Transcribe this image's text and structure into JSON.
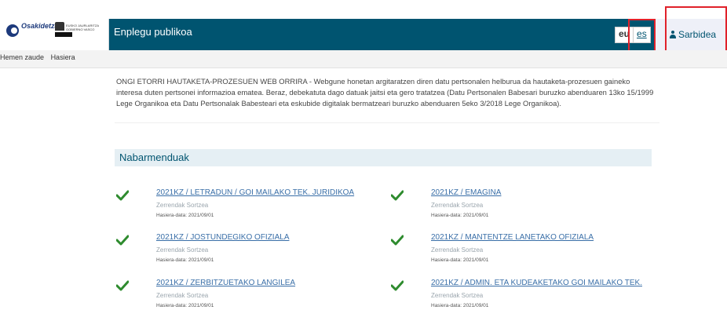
{
  "header": {
    "logo_text": "Osakidetza",
    "gov_text": "EUSKO JAURLARITZA GOBIERNO VASCO",
    "app_title": "Enplegu publikoa",
    "languages": [
      {
        "code": "eu",
        "active": true
      },
      {
        "code": "es",
        "active": false
      }
    ],
    "login_label": "Sarbidea",
    "colors": {
      "header_bg": "#005470",
      "highlight": "#e0212a"
    }
  },
  "breadcrumb": {
    "prefix": "Hemen zaude",
    "current": "Hasiera"
  },
  "intro": {
    "text": "ONGI ETORRI HAUTAKETA-PROZESUEN WEB ORRIRA - Webgune honetan argitaratzen diren datu pertsonalen helburua da hautaketa-prozesuen gaineko interesa duten pertsonei informazioa ematea. Beraz, debekatuta dago datuak jaitsi eta gero tratatzea (Datu Pertsonalen Babesari buruzko abenduaren 13ko 15/1999 Lege Organikoa eta Datu Pertsonalak Babesteari eta eskubide digitalak bermatzeari buruzko abenduaren 5eko 3/2018 Lege Organikoa)."
  },
  "featured": {
    "title": "Nabarmenduak",
    "items": [
      {
        "link": "2021KZ / LETRADUN / GOI MAILAKO TEK. JURIDIKOA",
        "status": "Zerrendak Sortzea",
        "date": "Hasiera-data: 2021/09/01",
        "icon": "check-icon"
      },
      {
        "link": "2021KZ / EMAGINA",
        "status": "Zerrendak Sortzea",
        "date": "Hasiera-data: 2021/09/01",
        "icon": "check-icon"
      },
      {
        "link": "2021KZ / JOSTUNDEGIKO OFIZIALA",
        "status": "Zerrendak Sortzea",
        "date": "Hasiera-data: 2021/09/01",
        "icon": "check-icon"
      },
      {
        "link": "2021KZ / MANTENTZE LANETAKO OFIZIALA",
        "status": "Zerrendak Sortzea",
        "date": "Hasiera-data: 2021/09/01",
        "icon": "check-icon"
      },
      {
        "link": "2021KZ / ZERBITZUETAKO LANGILEA",
        "status": "Zerrendak Sortzea",
        "date": "Hasiera-data: 2021/09/01",
        "icon": "check-icon"
      },
      {
        "link": "2021KZ / ADMIN. ETA KUDEAKETAKO GOI MAILAKO TEK.",
        "status": "Zerrendak Sortzea",
        "date": "Hasiera-data: 2021/09/01",
        "icon": "check-icon"
      }
    ]
  }
}
